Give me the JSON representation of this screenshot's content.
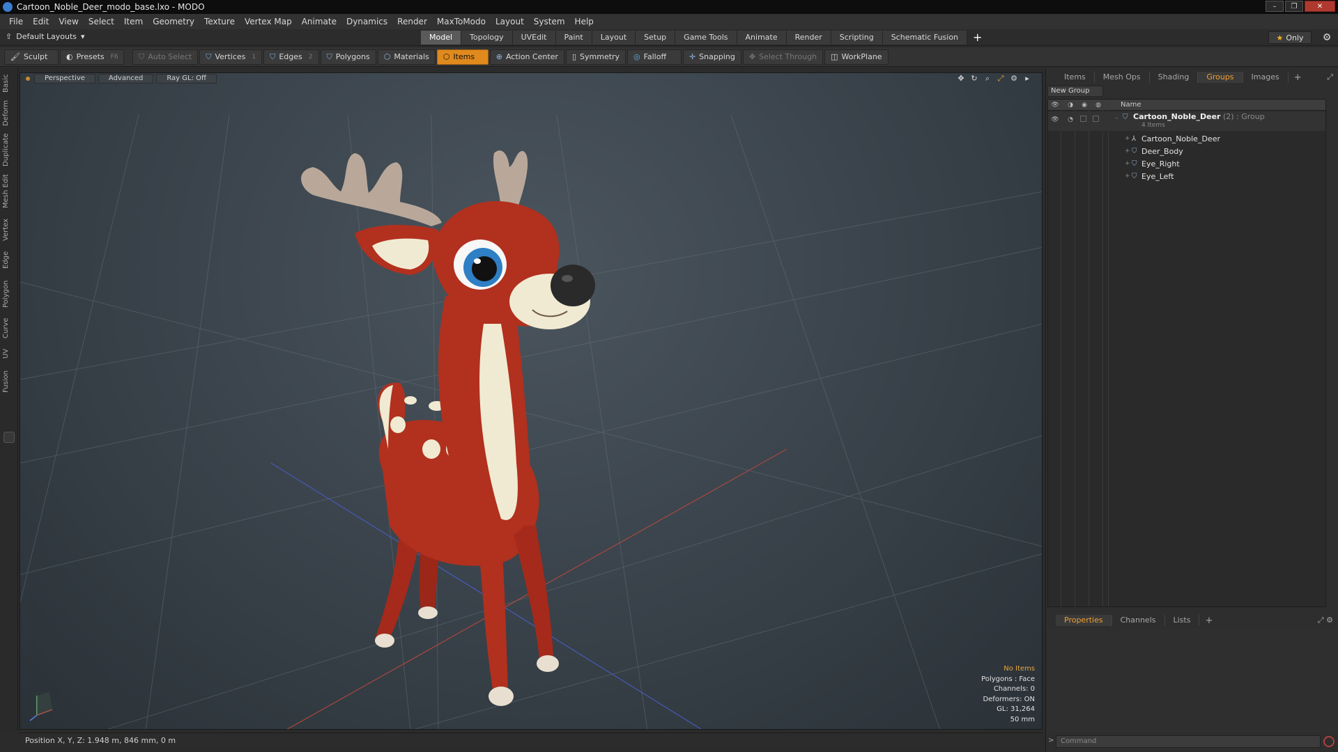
{
  "window": {
    "title": "Cartoon_Noble_Deer_modo_base.lxo - MODO",
    "controls": {
      "minimize": "–",
      "restore": "❐",
      "close": "✕"
    }
  },
  "menu": [
    "File",
    "Edit",
    "View",
    "Select",
    "Item",
    "Geometry",
    "Texture",
    "Vertex Map",
    "Animate",
    "Dynamics",
    "Render",
    "MaxToModo",
    "Layout",
    "System",
    "Help"
  ],
  "layoutbar": {
    "layouts_label": "Default Layouts",
    "tabs": [
      "Model",
      "Topology",
      "UVEdit",
      "Paint",
      "Layout",
      "Setup",
      "Game Tools",
      "Animate",
      "Render",
      "Scripting",
      "Schematic Fusion"
    ],
    "active_tab": "Model",
    "add": "+",
    "only_label": "Only"
  },
  "toolbar": {
    "sculpt": "Sculpt",
    "presets": "Presets",
    "presets_key": "F6",
    "auto_select": "Auto Select",
    "vertices": "Vertices",
    "vertices_key": "1",
    "edges": "Edges",
    "edges_key": "2",
    "polygons": "Polygons",
    "materials": "Materials",
    "items": "Items",
    "action_center": "Action Center",
    "symmetry": "Symmetry",
    "falloff": "Falloff",
    "snapping": "Snapping",
    "select_through": "Select Through",
    "workplane": "WorkPlane"
  },
  "left_tabs": [
    "Basic",
    "Deform",
    "Duplicate",
    "Mesh Edit",
    "Vertex",
    "Edge",
    "Polygon",
    "Curve",
    "UV",
    "Fusion"
  ],
  "viewport": {
    "view": "Perspective",
    "mode": "Advanced",
    "raygl": "Ray GL: Off",
    "info": {
      "selection": "No Items",
      "polygons": "Polygons : Face",
      "channels": "Channels: 0",
      "deformers": "Deformers: ON",
      "gl": "GL: 31,264",
      "lens": "50 mm"
    }
  },
  "status": "Position X, Y, Z:  1.948 m, 846 mm, 0 m",
  "right_panel": {
    "tabs": [
      "Items",
      "Mesh Ops",
      "Shading",
      "Groups",
      "Images"
    ],
    "active_tab": "Groups",
    "add": "+",
    "new_group": "New Group",
    "name_header": "Name",
    "group": {
      "name": "Cartoon_Noble_Deer",
      "meta": " (2) : Group",
      "sub": "4 Items"
    },
    "items": [
      "Cartoon_Noble_Deer",
      "Deer_Body",
      "Eye_Right",
      "Eye_Left"
    ],
    "bottom_tabs": [
      "Properties",
      "Channels",
      "Lists"
    ],
    "bottom_active": "Properties",
    "command_placeholder": "Command"
  },
  "colors": {
    "accent": "#e08a1e",
    "deer_red": "#b2301e",
    "deer_cream": "#f1ead2",
    "antler": "#b9a89a"
  }
}
